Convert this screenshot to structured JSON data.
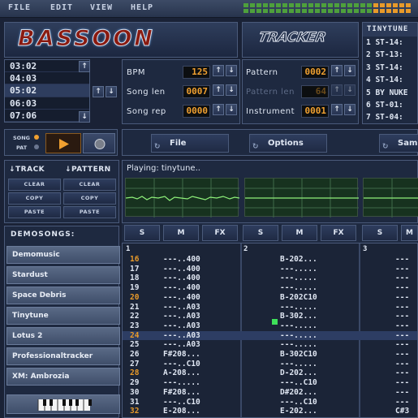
{
  "menu": {
    "items": [
      "FILE",
      "EDIT",
      "VIEW",
      "HELP"
    ]
  },
  "logo": {
    "text": "BASSOON",
    "subtext": "TRACKER"
  },
  "songlist": {
    "title": "TINYTUNE",
    "items": [
      "1 ST-14:",
      "2 ST-13:",
      "3 ST-14:",
      "4 ST-14:",
      "5 BY NUKE",
      "6 ST-01:",
      "7 ST-04:"
    ]
  },
  "positions": [
    "03:02",
    "04:03",
    "05:02",
    "06:03",
    "07:06"
  ],
  "params": {
    "bpm": {
      "label": "BPM",
      "value": "125"
    },
    "song_len": {
      "label": "Song len",
      "value": "0007"
    },
    "song_rep": {
      "label": "Song rep",
      "value": "0000"
    },
    "pattern": {
      "label": "Pattern",
      "value": "0002"
    },
    "pattern_len": {
      "label": "Pattern len",
      "value": "64"
    },
    "instrument": {
      "label": "Instrument",
      "value": "0001"
    }
  },
  "transport": {
    "song_label": "SONG",
    "pat_label": "PAT"
  },
  "menubuttons": {
    "file": "File",
    "options": "Options",
    "sample": "Samp"
  },
  "edit": {
    "track_label": "↓TRACK",
    "pattern_label": "↓PATTERN",
    "clear": "CLEAR",
    "copy": "COPY",
    "paste": "PASTE"
  },
  "demosongs": {
    "title": "DEMOSONGS:",
    "items": [
      "Demomusic",
      "Stardust",
      "Space Debris",
      "Tinytune",
      "Lotus 2",
      "Professionaltracker",
      "XM: Ambrozia"
    ]
  },
  "status": "Playing: tinytune..",
  "trackbuttons": {
    "s": "S",
    "m": "M",
    "fx": "FX"
  },
  "tracks": {
    "t1": "1",
    "t2": "2",
    "t3": "3"
  },
  "pattern_rows": [
    {
      "n": "16",
      "c1": "---..400",
      "c2": "B-202...",
      "c3": "---"
    },
    {
      "n": "17",
      "c1": "---..400",
      "c2": "---.....",
      "c3": "---"
    },
    {
      "n": "18",
      "c1": "---..400",
      "c2": "---.....",
      "c3": "---"
    },
    {
      "n": "19",
      "c1": "---..400",
      "c2": "---.....",
      "c3": "---"
    },
    {
      "n": "20",
      "c1": "---..400",
      "c2": "B-202C10",
      "c3": "---"
    },
    {
      "n": "21",
      "c1": "---..A03",
      "c2": "---.....",
      "c3": "---"
    },
    {
      "n": "22",
      "c1": "---..A03",
      "c2": "B-302...",
      "c3": "---"
    },
    {
      "n": "23",
      "c1": "---..A03",
      "c2": "---.....",
      "c3": "---"
    },
    {
      "n": "24",
      "c1": "---..A03",
      "c2": "---.....",
      "c3": "---"
    },
    {
      "n": "25",
      "c1": "---..A03",
      "c2": "---.....",
      "c3": "---"
    },
    {
      "n": "26",
      "c1": "F#208...",
      "c2": "B-302C10",
      "c3": "---"
    },
    {
      "n": "27",
      "c1": "---..C10",
      "c2": "---.....",
      "c3": "---"
    },
    {
      "n": "28",
      "c1": "A-208...",
      "c2": "D-202...",
      "c3": "---"
    },
    {
      "n": "29",
      "c1": "---.....",
      "c2": "---..C10",
      "c3": "---"
    },
    {
      "n": "30",
      "c1": "F#208...",
      "c2": "D#202...",
      "c3": "---"
    },
    {
      "n": "31",
      "c1": "---..C10",
      "c2": "---..C10",
      "c3": "---"
    },
    {
      "n": "32",
      "c1": "E-208...",
      "c2": "E-202...",
      "c3": "C#3"
    }
  ]
}
